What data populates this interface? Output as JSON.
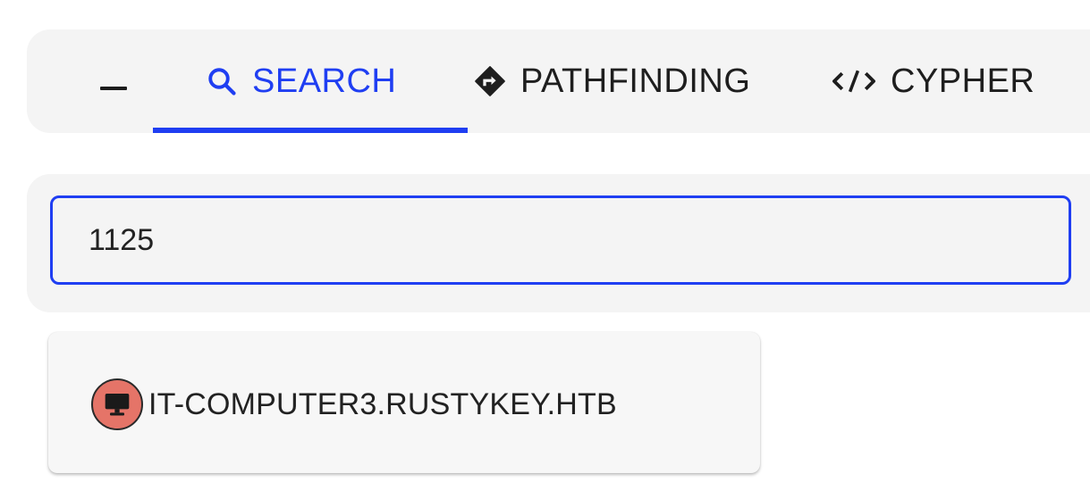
{
  "tabs": {
    "collapse_icon": "minus-icon",
    "items": [
      {
        "label": "SEARCH",
        "icon": "search-icon",
        "active": true
      },
      {
        "label": "PATHFINDING",
        "icon": "directions-diamond-icon",
        "active": false
      },
      {
        "label": "CYPHER",
        "icon": "code-icon",
        "active": false
      }
    ],
    "accent_color": "#1f3ef2"
  },
  "search": {
    "value": "1125",
    "border_color": "#1f3ef2"
  },
  "results": {
    "items": [
      {
        "label": "IT-COMPUTER3.RUSTYKEY.HTB",
        "icon": "computer-icon",
        "icon_color": "#e57468"
      }
    ]
  }
}
